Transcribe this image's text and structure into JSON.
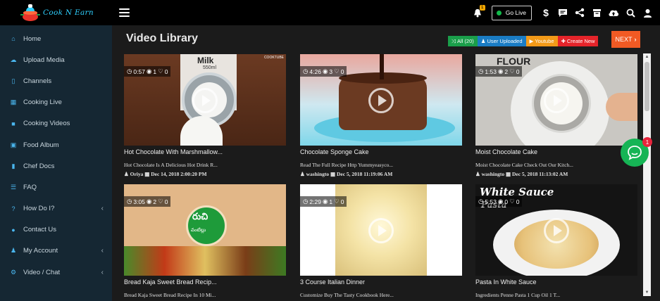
{
  "brand": {
    "name": "Cook N Earn"
  },
  "sidebar": {
    "items": [
      {
        "label": "Home",
        "icon": "home-icon"
      },
      {
        "label": "Upload Media",
        "icon": "cloud-upload-icon"
      },
      {
        "label": "Channels",
        "icon": "bookmark-icon"
      },
      {
        "label": "Cooking Live",
        "icon": "calendar-icon"
      },
      {
        "label": "Cooking Videos",
        "icon": "video-camera-icon"
      },
      {
        "label": "Food Album",
        "icon": "image-icon"
      },
      {
        "label": "Chef Docs",
        "icon": "document-icon"
      },
      {
        "label": "FAQ",
        "icon": "sliders-icon"
      },
      {
        "label": "How Do I?",
        "icon": "question-icon",
        "chevron": "‹"
      },
      {
        "label": "Contact Us",
        "icon": "map-marker-icon"
      },
      {
        "label": "My Account",
        "icon": "user-icon",
        "chevron": "‹"
      },
      {
        "label": "Video / Chat",
        "icon": "cogs-icon",
        "chevron": "‹"
      }
    ]
  },
  "topbar": {
    "bell_count": "1",
    "golive_label": "Go Live"
  },
  "main": {
    "title": "Video Library",
    "filters": {
      "all": "All (20)",
      "user_uploaded": "User Uploaded",
      "youtube": "Youtube",
      "create_new": "Create New"
    },
    "next_label": "NEXT"
  },
  "videos": [
    {
      "duration": "0:57",
      "views": "1",
      "likes": "0",
      "title": "Hot Chocolate With Marshmallow...",
      "desc": "Hot Chocolate Is A Delicious Hot Drink R...",
      "author": "Oriya",
      "date": "Dec 14, 2018 2:00:20 PM",
      "overlay": "Milk",
      "overlay_sub": "550ml",
      "corner": "COOKTUBE"
    },
    {
      "duration": "4:26",
      "views": "3",
      "likes": "0",
      "title": "Chocolate Sponge Cake",
      "desc": "Read The Full Recipe Http Yummyeasyco...",
      "author": "washingto",
      "date": "Dec 5, 2018 11:19:06 AM",
      "overlay": "",
      "overlay_sub": "",
      "corner": ""
    },
    {
      "duration": "1:53",
      "views": "2",
      "likes": "0",
      "title": "Moist Chocolate Cake",
      "desc": "Moist Chocolate Cake Check Out Our Kitch...",
      "author": "washingto",
      "date": "Dec 5, 2018 11:13:02 AM",
      "overlay": "FLOUR",
      "overlay_sub": "",
      "corner": ""
    },
    {
      "duration": "3:05",
      "views": "2",
      "likes": "0",
      "title": "Bread Kaja Sweet Bread Recip...",
      "desc": "Bread Kaja Sweet Bread Recipe In 10 Mi...",
      "author": "",
      "date": "",
      "overlay": "రుచి",
      "overlay_sub": "వంటిల్లు",
      "corner": ""
    },
    {
      "duration": "2:29",
      "views": "1",
      "likes": "0",
      "title": "3 Course Italian Dinner",
      "desc": "Customize Buy The Tasty Cookbook Here...",
      "author": "",
      "date": "",
      "overlay": "",
      "overlay_sub": "",
      "corner": ""
    },
    {
      "duration": "5:53",
      "views": "0",
      "likes": "0",
      "title": "Pasta In White Sauce",
      "desc": "Ingredients Penne Pasta 1 Cup Oil 1 T...",
      "author": "",
      "date": "",
      "overlay": "White Sauce",
      "overlay_sub": "Pasta",
      "corner": ""
    }
  ],
  "chat": {
    "badge": "1"
  }
}
